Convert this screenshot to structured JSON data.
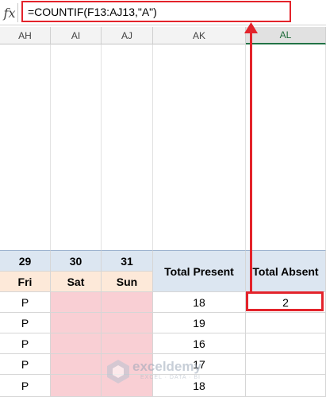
{
  "formula_bar": {
    "fx_label": "fx",
    "formula": "=COUNTIF(F13:AJ13,\"A\")"
  },
  "columns": [
    "AH",
    "AI",
    "AJ",
    "AK",
    "AL"
  ],
  "selected_column": "AL",
  "table": {
    "days": [
      {
        "date": "29",
        "weekday": "Fri"
      },
      {
        "date": "30",
        "weekday": "Sat"
      },
      {
        "date": "31",
        "weekday": "Sun"
      }
    ],
    "total_present_header": "Total Present",
    "total_absent_header": "Total Absent",
    "rows": [
      {
        "ah": "P",
        "total_present": "18",
        "total_absent": "2"
      },
      {
        "ah": "P",
        "total_present": "19",
        "total_absent": ""
      },
      {
        "ah": "P",
        "total_present": "16",
        "total_absent": ""
      },
      {
        "ah": "P",
        "total_present": "17",
        "total_absent": ""
      },
      {
        "ah": "P",
        "total_present": "18",
        "total_absent": ""
      }
    ]
  },
  "watermark": {
    "name": "exceldemy",
    "tagline": "EXCEL · DATA · BI"
  },
  "colors": {
    "highlight": "#e3232b",
    "header_blue": "#dce6f1",
    "header_peach": "#fde9d9",
    "weekend_pink": "#f9cfd4"
  }
}
